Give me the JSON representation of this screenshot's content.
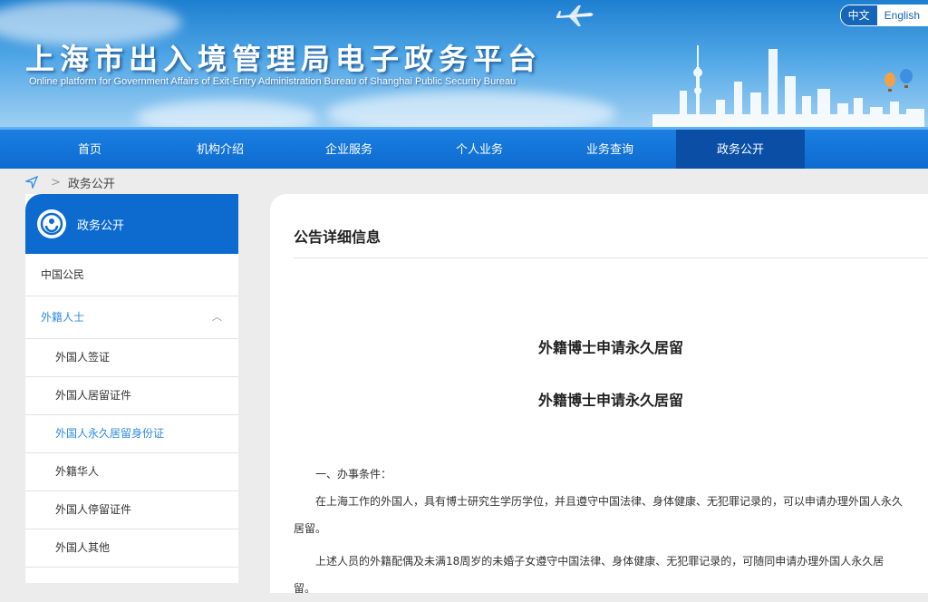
{
  "header": {
    "title": "上海市出入境管理局电子政务平台",
    "subtitle": "Online platform for Government Affairs of Exit-Entry Administration Bureau of Shanghai Public Security Bureau",
    "lang": {
      "cn": "中文",
      "en": "English"
    }
  },
  "nav": {
    "items": [
      {
        "label": "首页"
      },
      {
        "label": "机构介绍"
      },
      {
        "label": "企业服务"
      },
      {
        "label": "个人业务"
      },
      {
        "label": "业务查询"
      },
      {
        "label": "政务公开"
      }
    ],
    "active": "政务公开"
  },
  "breadcrumb": {
    "current": "政务公开"
  },
  "sidebar": {
    "title": "政务公开",
    "items": [
      {
        "label": "中国公民"
      },
      {
        "label": "外籍人士"
      },
      {
        "label": "外国人签证"
      },
      {
        "label": "外国人居留证件"
      },
      {
        "label": "外国人永久居留身份证"
      },
      {
        "label": "外籍华人"
      },
      {
        "label": "外国人停留证件"
      },
      {
        "label": "外国人其他"
      }
    ]
  },
  "main": {
    "panel_title": "公告详细信息",
    "article_title_1": "外籍博士申请永久居留",
    "article_title_2": "外籍博士申请永久居留",
    "section_heading": "一、办事条件：",
    "para_1": "在上海工作的外国人，具有博士研究生学历学位，并且遵守中国法律、身体健康、无犯罪记录的，可以申请办理外国人永久居留。",
    "para_2": "上述人员的外籍配偶及未满18周岁的未婚子女遵守中国法律、身体健康、无犯罪记录的，可随同申请办理外国人永久居留。"
  },
  "colors": {
    "nav_blue": "#0d6bd0",
    "nav_active": "#0a4fa5",
    "link_blue": "#2e8be3",
    "page_bg": "#ececec"
  }
}
